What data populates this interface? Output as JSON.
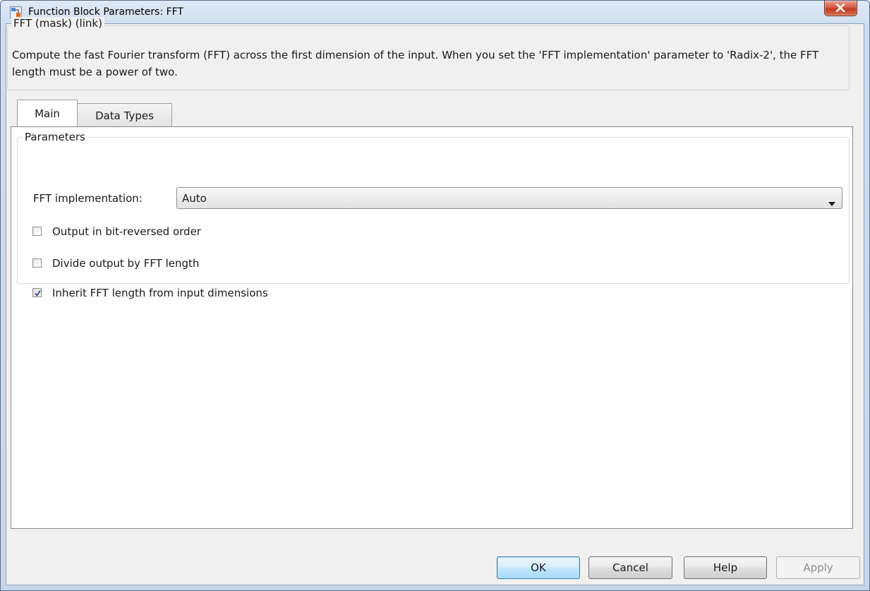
{
  "window": {
    "title": "Function Block Parameters: FFT"
  },
  "mask": {
    "heading": "FFT (mask) (link)",
    "description": "Compute the fast Fourier transform (FFT) across the first dimension of the input. When you set the 'FFT implementation' parameter to 'Radix-2', the FFT length must be a power of two."
  },
  "tabs": [
    {
      "label": "Main",
      "active": true
    },
    {
      "label": "Data Types",
      "active": false
    }
  ],
  "parameters": {
    "group_label": "Parameters",
    "fft_implementation_label": "FFT implementation:",
    "fft_implementation_value": "Auto",
    "checkboxes": [
      {
        "label": "Output in bit-reversed order",
        "checked": false
      },
      {
        "label": "Divide output by FFT length",
        "checked": false
      },
      {
        "label": "Inherit FFT length from input dimensions",
        "checked": true
      }
    ]
  },
  "buttons": {
    "ok": "OK",
    "cancel": "Cancel",
    "help": "Help",
    "apply": "Apply"
  },
  "colors": {
    "close_button": "#c23a22",
    "default_button_border": "#3c7fb1",
    "window_frame": "#c7d7ea"
  }
}
